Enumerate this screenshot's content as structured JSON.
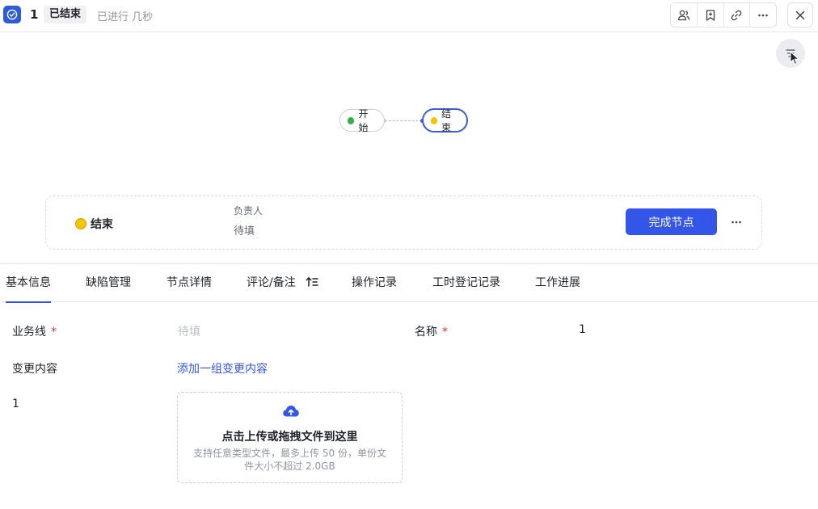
{
  "header": {
    "task_number": "1",
    "status": "已结束",
    "duration": "已进行 几秒"
  },
  "flow": {
    "start_node": {
      "label": "开始",
      "color": "#2fb344"
    },
    "end_node": {
      "label": "结束",
      "color": "#f5c400"
    },
    "accent": "#3b5bdb"
  },
  "node_card": {
    "name": "结束",
    "owner_label": "负责人",
    "owner_placeholder": "待填",
    "complete_button": "完成节点"
  },
  "tabs": [
    {
      "label": "基本信息",
      "active": true
    },
    {
      "label": "缺陷管理",
      "active": false
    },
    {
      "label": "节点详情",
      "active": false
    },
    {
      "label": "评论/备注",
      "active": false
    },
    {
      "label": "操作记录",
      "active": false
    },
    {
      "label": "工时登记记录",
      "active": false
    },
    {
      "label": "工作进展",
      "active": false
    }
  ],
  "form": {
    "business_line": {
      "label": "业务线",
      "required_mark": "*",
      "placeholder": "待填"
    },
    "name": {
      "label": "名称",
      "required_mark": "*",
      "value": "1"
    },
    "change_content": {
      "label": "变更内容",
      "link": "添加一组变更内容"
    },
    "item_label": "1",
    "upload": {
      "title": "点击上传或拖拽文件到这里",
      "description": "支持任意类型文件，最多上传 50 份，单份文件大小不超过 2.0GB"
    }
  },
  "icons": {
    "app": "check-circle-icon",
    "members": "members-icon",
    "bookmark": "bookmark-icon",
    "link": "link-icon",
    "more": "more-icon",
    "close": "close-icon",
    "filter": "filter-icon",
    "sort": "sort-icon",
    "upload": "cloud-upload-icon"
  }
}
